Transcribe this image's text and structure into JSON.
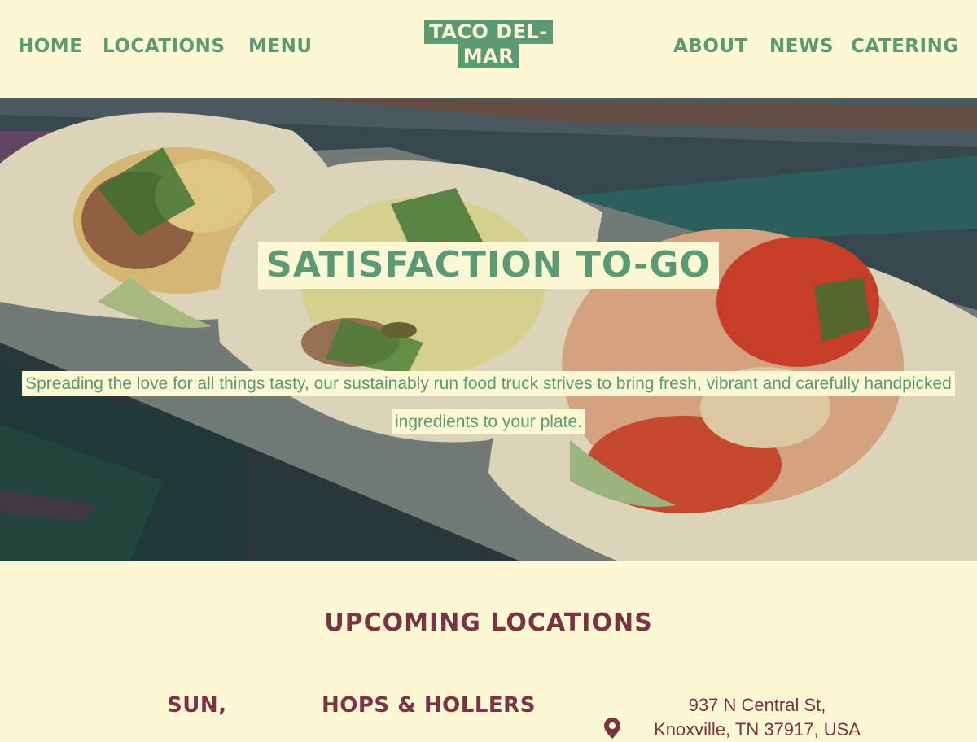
{
  "header": {
    "nav_left": [
      {
        "label": "Home"
      },
      {
        "label": "Locations"
      },
      {
        "label": "Menu"
      }
    ],
    "logo": {
      "line1": "TACO DEL-",
      "line2": "MAR"
    },
    "nav_right": [
      {
        "label": "About"
      },
      {
        "label": "News"
      },
      {
        "label": "Catering"
      }
    ]
  },
  "hero": {
    "title": "SATISFACTION TO-GO",
    "text": "Spreading the love for all things tasty, our sustainably run food truck strives to bring fresh, vibrant and carefully handpicked ingredients to your plate."
  },
  "locations": {
    "heading": "UPCOMING LOCATIONS",
    "items": [
      {
        "day": "SUN,",
        "venue": "HOPS & HOLLERS",
        "address_line1": "937 N Central St,",
        "address_line2": "Knoxville, TN 37917, USA",
        "icon": "location-pin-icon"
      }
    ]
  },
  "colors": {
    "background": "#fdf8d4",
    "green": "#5b9a74",
    "maroon": "#7a3344"
  }
}
